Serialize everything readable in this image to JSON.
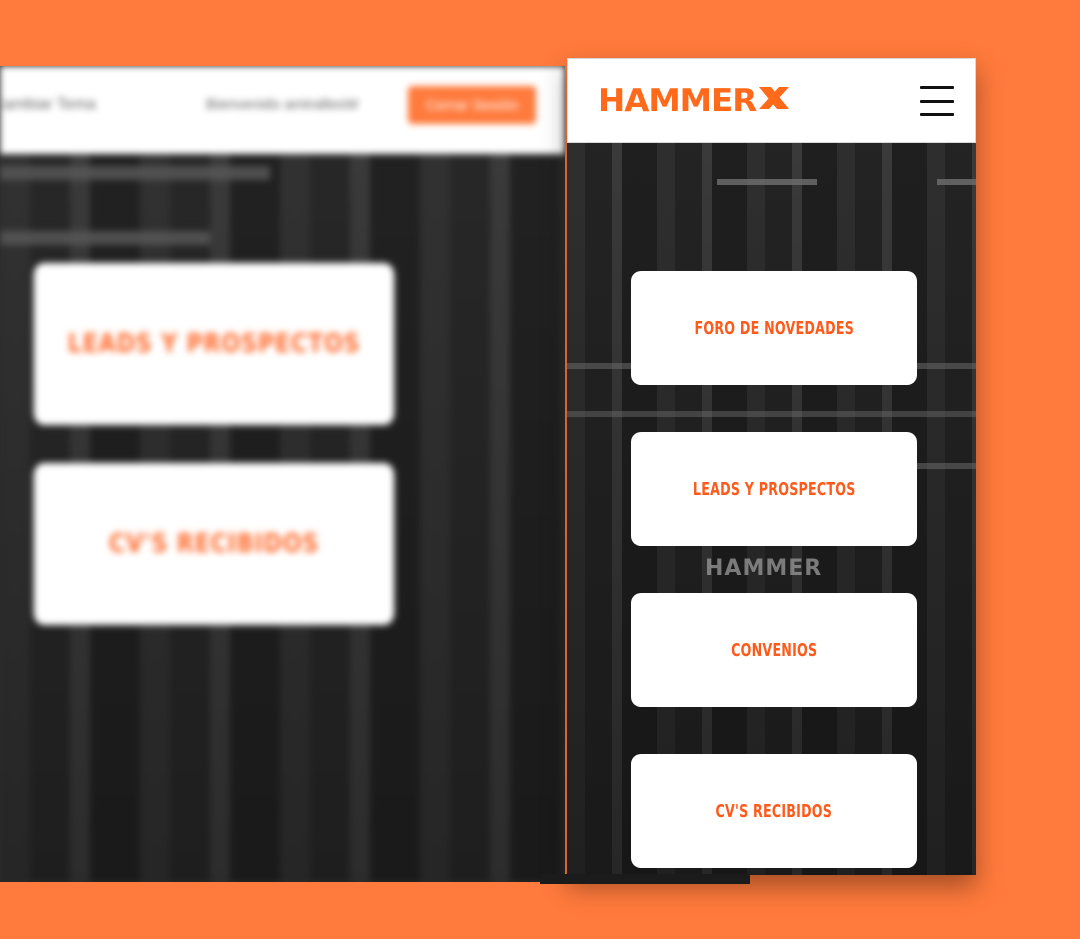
{
  "colors": {
    "background": "#FF7A3C",
    "accent": "#FF5A1A",
    "card": "#FFFFFF",
    "header": "#FFFFFF"
  },
  "desktop_preview": {
    "nav_link": "Cambiar Tema",
    "welcome_text": "Bienvenido amirallesW",
    "logout_button": "Cerrar Sesión",
    "cards": [
      {
        "label": "LEADS Y PROSPECTOS"
      },
      {
        "label": "CV'S RECIBIDOS"
      }
    ]
  },
  "mobile": {
    "logo": {
      "word": "HAMMER",
      "mark": "X"
    },
    "menu_icon": "hamburger-menu-icon",
    "wall_sign": "HAMMER",
    "cards": [
      {
        "label": "FORO DE NOVEDADES"
      },
      {
        "label": "LEADS Y PROSPECTOS"
      },
      {
        "label": "CONVENIOS"
      },
      {
        "label": "CV'S RECIBIDOS"
      }
    ]
  }
}
